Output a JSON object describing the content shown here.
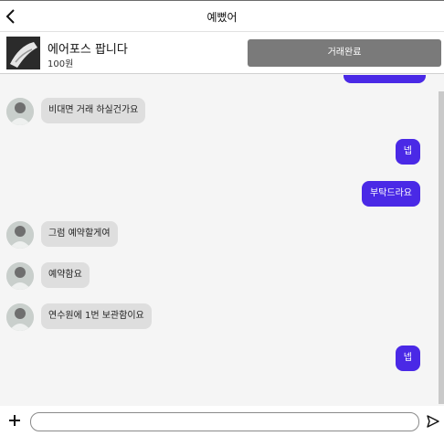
{
  "header": {
    "title": "예뻤어"
  },
  "product": {
    "name": "에어포스 팝니다",
    "price": "100원",
    "action_label": "거래완료"
  },
  "messages": [
    {
      "from": "other",
      "text": "비대면 거래 하실건가요"
    },
    {
      "from": "me",
      "text": "넵"
    },
    {
      "from": "me",
      "text": "부탁드라요"
    },
    {
      "from": "other",
      "text": "그럼 예약할게여"
    },
    {
      "from": "other",
      "text": "예약함요"
    },
    {
      "from": "other",
      "text": "연수원에 1번 보관함이요"
    },
    {
      "from": "me",
      "text": "넵"
    }
  ],
  "composer": {
    "value": "",
    "placeholder": ""
  },
  "colors": {
    "outgoing_bubble": "#4a29e6",
    "incoming_bubble": "#dedede",
    "done_button": "#7a7a7a"
  },
  "icons": {
    "back": "chevron-left-icon",
    "add": "plus-icon",
    "send": "send-icon"
  }
}
